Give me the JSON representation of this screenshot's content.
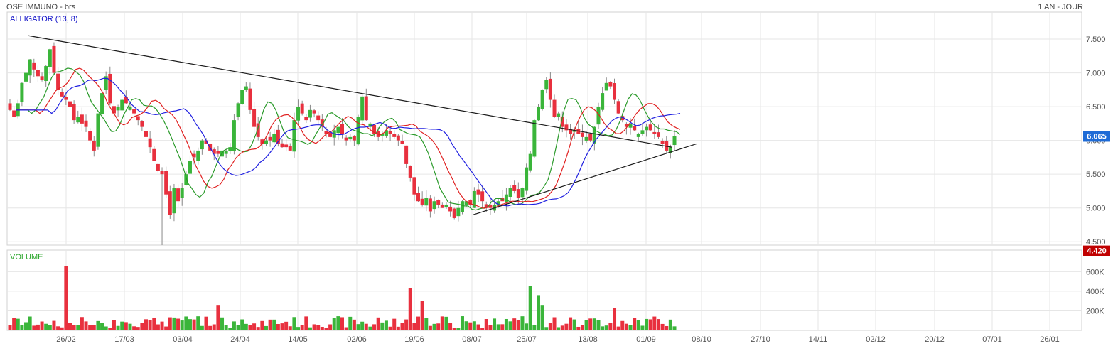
{
  "header": {
    "title": "OSE IMMUNO - brs",
    "period": "1 AN - JOUR"
  },
  "price_panel": {
    "indicator_label": "ALLIGATOR (13, 8)",
    "y_ticks": [
      "7.500",
      "7.000",
      "6.500",
      "6.000",
      "5.500",
      "5.000",
      "4.500"
    ],
    "last_price": "6.065",
    "min_price": "4.420"
  },
  "volume_panel": {
    "label": "VOLUME",
    "y_ticks": [
      "600K",
      "400K",
      "200K"
    ]
  },
  "x_ticks": [
    "26/02",
    "17/03",
    "03/04",
    "24/04",
    "14/05",
    "02/06",
    "19/06",
    "08/07",
    "25/07",
    "13/08",
    "01/09",
    "08/10",
    "27/10",
    "14/11",
    "02/12",
    "20/12",
    "07/01",
    "26/01"
  ],
  "colors": {
    "up": "#3ab53a",
    "down": "#e8303e",
    "alligator_fast": "#2a9a2a",
    "alligator_mid": "#e02020",
    "alligator_slow": "#2020e0",
    "trendline": "#1a1a1a",
    "last_price_badge": "#1e6bd6",
    "min_price_badge": "#c00000",
    "grid": "#e6e6e6"
  },
  "chart_data": {
    "type": "candlestick",
    "title": "OSE IMMUNO - brs",
    "period": "1 AN - JOUR",
    "y_range": [
      4.45,
      7.9
    ],
    "volume_range": [
      0,
      820000
    ],
    "x_ticks": [
      "26/02",
      "17/03",
      "03/04",
      "24/04",
      "14/05",
      "02/06",
      "19/06",
      "08/07",
      "25/07",
      "13/08",
      "01/09",
      "08/10",
      "27/10",
      "14/11",
      "02/12",
      "20/12",
      "07/01",
      "26/01"
    ],
    "close_start": 6.45,
    "close_end": 6.065,
    "close_series": [
      6.45,
      6.35,
      6.55,
      6.85,
      7.0,
      7.2,
      7.05,
      6.95,
      6.9,
      7.1,
      7.35,
      7.0,
      6.75,
      6.65,
      6.6,
      6.5,
      6.3,
      6.35,
      6.25,
      6.2,
      6.0,
      5.85,
      6.4,
      6.7,
      6.95,
      6.55,
      6.4,
      6.5,
      6.6,
      6.55,
      6.5,
      6.4,
      6.3,
      6.2,
      6.05,
      5.9,
      5.7,
      5.55,
      5.5,
      5.2,
      4.9,
      5.3,
      5.1,
      5.3,
      5.5,
      5.7,
      5.75,
      5.85,
      6.0,
      5.95,
      5.85,
      5.8,
      5.8,
      5.85,
      5.85,
      5.9,
      6.3,
      6.55,
      6.75,
      6.8,
      6.45,
      6.2,
      6.05,
      5.95,
      6.0,
      6.0,
      6.1,
      5.95,
      5.9,
      5.9,
      5.85,
      6.3,
      6.5,
      6.4,
      6.3,
      6.45,
      6.4,
      6.3,
      6.2,
      6.1,
      6.05,
      6.15,
      6.2,
      6.1,
      6.0,
      6.05,
      6.0,
      6.35,
      6.65,
      6.3,
      6.25,
      6.1,
      6.05,
      6.1,
      6.15,
      6.1,
      6.05,
      6.0,
      5.95,
      5.65,
      5.45,
      5.2,
      5.1,
      5.05,
      5.15,
      4.95,
      5.1,
      5.05,
      5.0,
      5.05,
      4.95,
      4.85,
      5.0,
      5.1,
      5.1,
      5.05,
      5.25,
      5.2,
      5.1,
      5.0,
      5.0,
      5.05,
      5.1,
      5.1,
      5.2,
      5.3,
      5.25,
      5.15,
      5.3,
      5.6,
      5.8,
      6.3,
      6.5,
      6.75,
      6.9,
      6.6,
      6.35,
      6.4,
      6.2,
      6.15,
      6.1,
      6.15,
      6.1,
      6.05,
      6.05,
      6.0,
      6.2,
      6.5,
      6.7,
      6.85,
      6.8,
      6.6,
      6.4,
      6.3,
      6.2,
      6.25,
      6.15,
      6.1,
      6.15,
      6.2,
      6.15,
      6.1,
      6.05,
      5.95,
      5.85,
      5.9,
      6.065
    ],
    "trendlines": [
      {
        "from": {
          "price": 7.55
        },
        "to": {
          "price": 5.9
        }
      },
      {
        "from": {
          "price": 4.9
        },
        "to": {
          "price": 5.95
        }
      }
    ],
    "series": [
      {
        "name": "ALLIGATOR (13, 8)",
        "type": "candlestick"
      },
      {
        "type": "line"
      },
      {
        "type": "line"
      },
      {
        "type": "line"
      },
      {
        "name": "VOLUME",
        "type": "bar"
      }
    ],
    "y_ticks": [
      "7.500",
      "7.000",
      "6.500",
      "6.000",
      "5.500",
      "5.000",
      "4.500"
    ],
    "volume_ticks": [
      "600K",
      "400K",
      "200K"
    ],
    "last_price": 6.065,
    "min_price": 4.42
  }
}
